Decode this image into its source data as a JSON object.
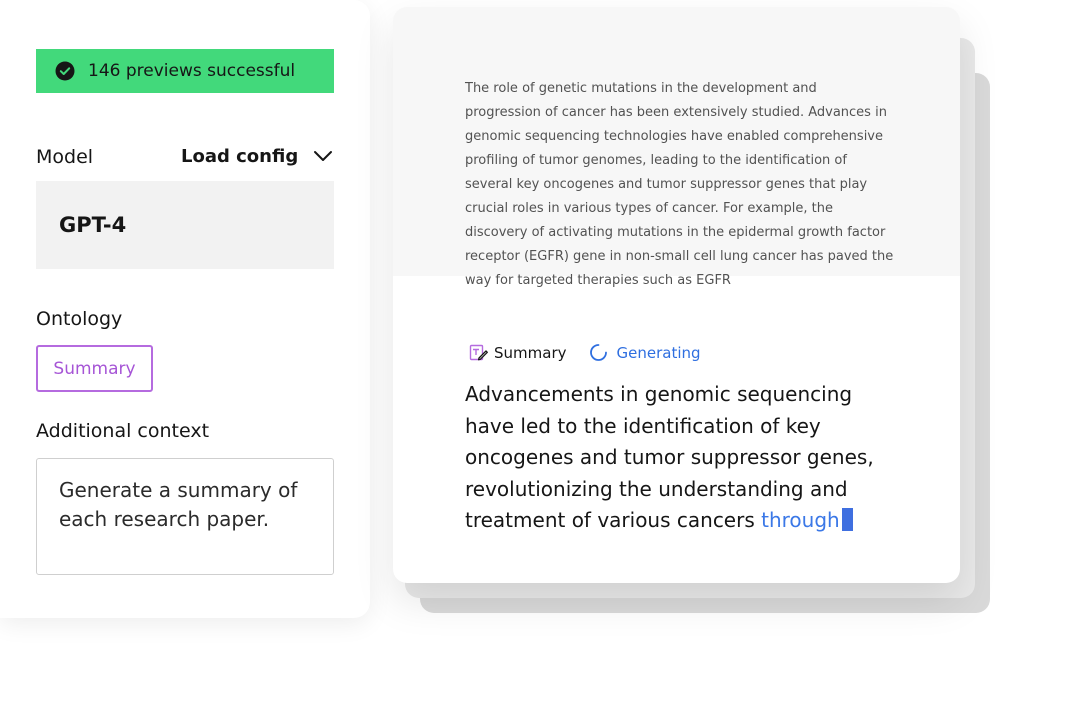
{
  "status": {
    "text": "146 previews successful",
    "icon": "check-circle-icon",
    "color": "#42d97b"
  },
  "model": {
    "label": "Model",
    "load_config_label": "Load config",
    "value": "GPT-4"
  },
  "ontology": {
    "label": "Ontology",
    "tag": "Summary",
    "tag_color": "#a655d6"
  },
  "context": {
    "label": "Additional context",
    "value": "Generate a summary of each research paper."
  },
  "source": {
    "text": "The role of genetic mutations in the development and progression of cancer has been extensively studied. Advances in genomic sequencing technologies have enabled comprehensive profiling of tumor genomes, leading to the identification of several key oncogenes and tumor suppressor genes that play crucial roles in various types of cancer. For example, the discovery of activating mutations in the epidermal growth factor receptor (EGFR) gene in non-small cell lung cancer has paved the way for targeted therapies such as EGFR"
  },
  "generation": {
    "label": "Summary",
    "status": "Generating",
    "status_color": "#2f6fe0",
    "output_text": "Advancements in genomic sequencing have led to the identification of key oncogenes and tumor suppressor genes, revolutionizing the understanding and treatment of various cancers ",
    "streaming_word": "through"
  }
}
